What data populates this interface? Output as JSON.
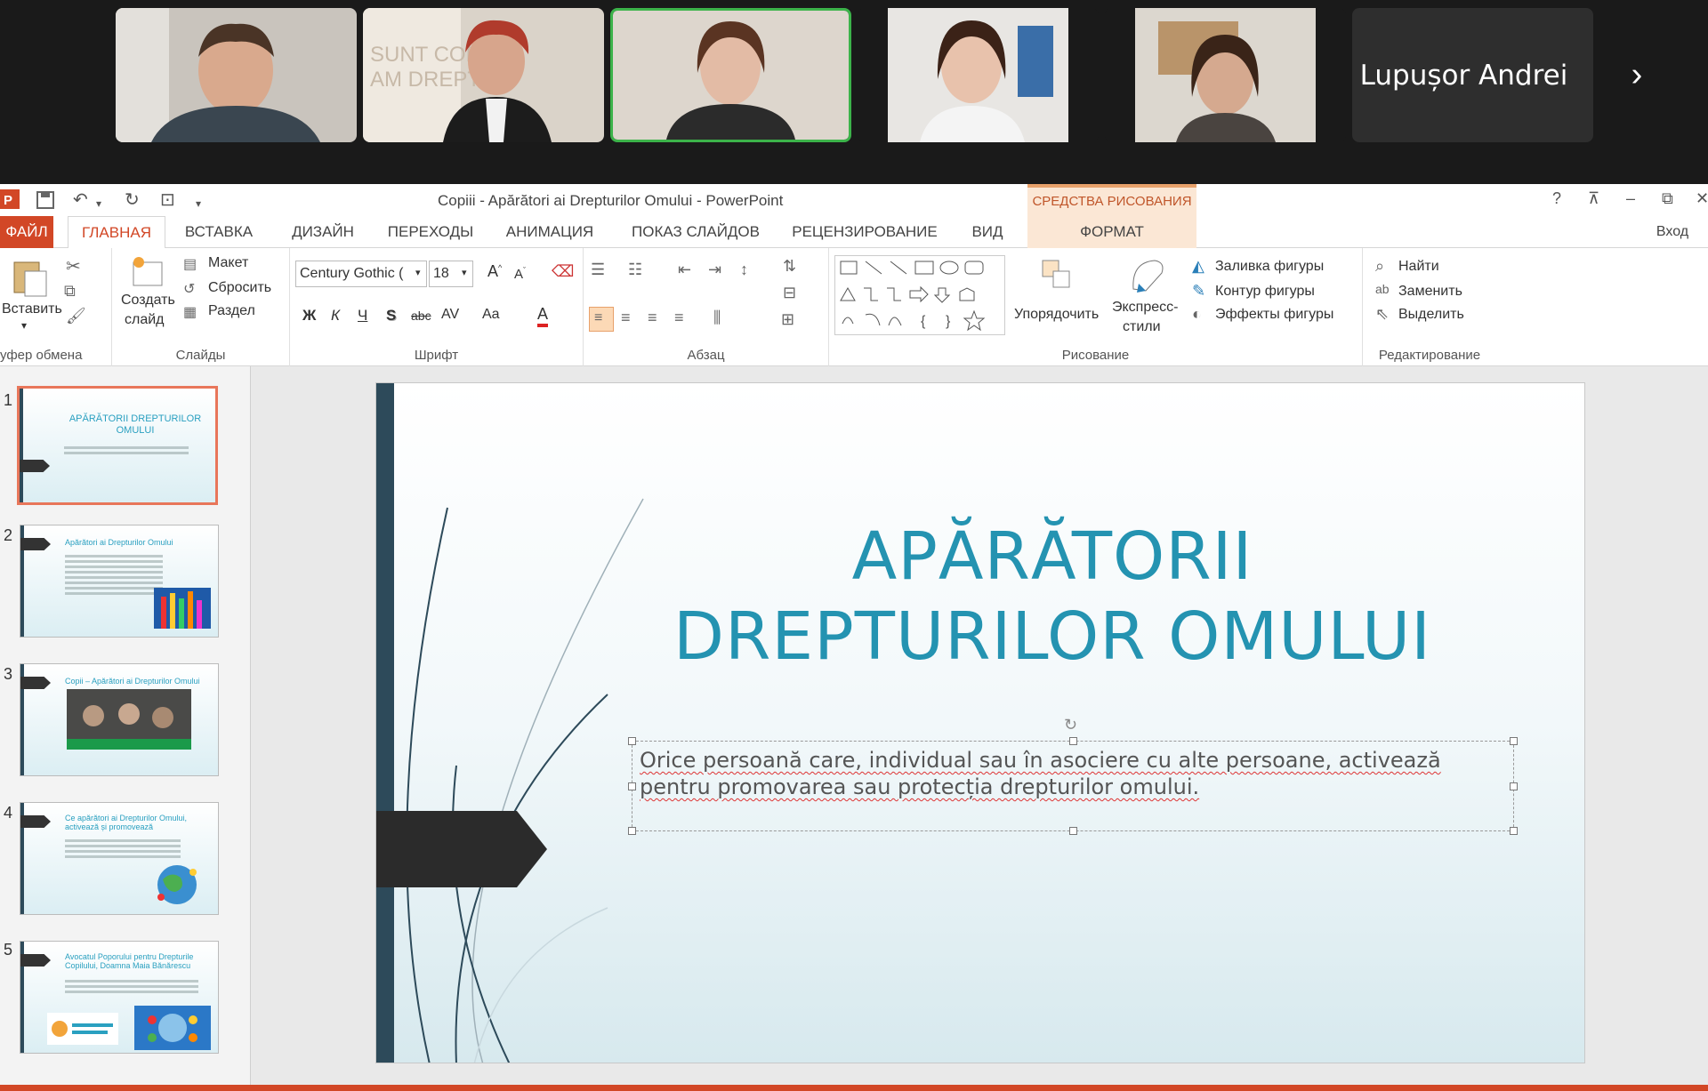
{
  "meeting": {
    "participant_name": "Lupușor Andrei",
    "next_label": "›"
  },
  "powerpoint": {
    "window_title": "Copiii - Apărători ai Drepturilor Omului - PowerPoint",
    "context_tab_group": "СРЕДСТВА РИСОВАНИЯ",
    "window_buttons": {
      "help": "?",
      "minimize": "–",
      "restore": "⧉",
      "close": "✕"
    },
    "tabs": [
      "ФАЙЛ",
      "ГЛАВНАЯ",
      "ВСТАВКА",
      "ДИЗАЙН",
      "ПЕРЕХОДЫ",
      "АНИМАЦИЯ",
      "ПОКАЗ СЛАЙДОВ",
      "РЕЦЕНЗИРОВАНИЕ",
      "ВИД",
      "ФОРМАТ"
    ],
    "signin": "Вход",
    "ribbon": {
      "clipboard": {
        "paste": "Вставить",
        "label": "уфер обмена"
      },
      "slides": {
        "new_slide_1": "Создать",
        "new_slide_2": "слайд",
        "layout": "Макет",
        "reset": "Сбросить",
        "section": "Раздел",
        "label": "Слайды"
      },
      "font": {
        "name": "Century Gothic (",
        "size": "18",
        "bold": "Ж",
        "italic": "К",
        "underline": "Ч",
        "shadow": "S",
        "strike": "abc",
        "spacing": "AV",
        "case": "Aa",
        "color": "A",
        "label": "Шрифт"
      },
      "paragraph": {
        "label": "Абзац"
      },
      "drawing": {
        "arrange": "Упорядочить",
        "quick_styles_1": "Экспресс-",
        "quick_styles_2": "стили",
        "shape_fill": "Заливка фигуры",
        "shape_outline": "Контур фигуры",
        "shape_effects": "Эффекты фигуры",
        "label": "Рисование"
      },
      "editing": {
        "find": "Найти",
        "replace": "Заменить",
        "select": "Выделить",
        "label": "Редактирование"
      }
    },
    "slide_numbers": [
      "1",
      "2",
      "3",
      "4",
      "5"
    ],
    "thumb_titles": [
      "APĂRĂTORII DREPTURILOR OMULUI",
      "Apărători ai Drepturilor Omului",
      "Copii – Apărători ai Drepturilor Omului",
      "Ce apărători ai Drepturilor Omului, activează și promovează",
      "Avocatul Poporului pentru Drepturile Copilului, Doamna Maia Bănărescu"
    ],
    "slide": {
      "title": "APĂRĂTORII DREPTURILOR OMULUI",
      "subtitle": "Orice persoană care, individual sau în asociere cu alte persoane, activează pentru promovarea sau protecția drepturilor omului."
    },
    "colors": {
      "accent": "#d24726",
      "title_blue": "#2493b1",
      "active_speaker": "#3cb34a"
    }
  }
}
